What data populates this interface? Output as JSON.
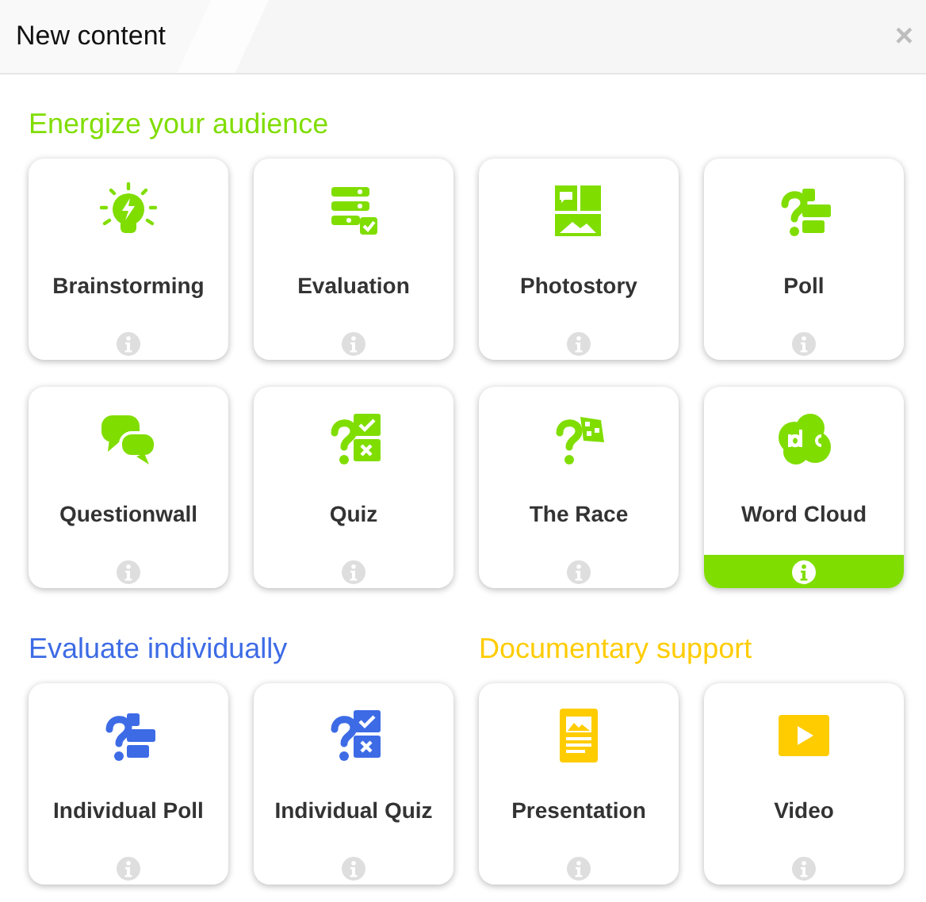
{
  "window": {
    "title": "New content",
    "close": "×"
  },
  "sections": [
    {
      "title": "Energize your audience",
      "color": "#80dd00",
      "items": [
        {
          "label": "Brainstorming",
          "kind": "bulb",
          "highlighted": false
        },
        {
          "label": "Evaluation",
          "kind": "evaluation",
          "highlighted": false
        },
        {
          "label": "Photostory",
          "kind": "photostory",
          "highlighted": false
        },
        {
          "label": "Poll",
          "kind": "poll",
          "highlighted": false
        },
        {
          "label": "Questionwall",
          "kind": "bubbles",
          "highlighted": false
        },
        {
          "label": "Quiz",
          "kind": "quiz",
          "highlighted": false
        },
        {
          "label": "The Race",
          "kind": "race",
          "highlighted": false
        },
        {
          "label": "Word Cloud",
          "kind": "cloud",
          "highlighted": true
        }
      ]
    },
    {
      "title": "Evaluate individually",
      "color": "#3d6be6",
      "items": [
        {
          "label": "Individual Poll",
          "kind": "poll",
          "highlighted": false
        },
        {
          "label": "Individual Quiz",
          "kind": "quiz",
          "highlighted": false
        }
      ]
    },
    {
      "title": "Documentary support",
      "color": "#ffcc00",
      "items": [
        {
          "label": "Presentation",
          "kind": "document",
          "highlighted": false
        },
        {
          "label": "Video",
          "kind": "video",
          "highlighted": false
        }
      ]
    }
  ]
}
